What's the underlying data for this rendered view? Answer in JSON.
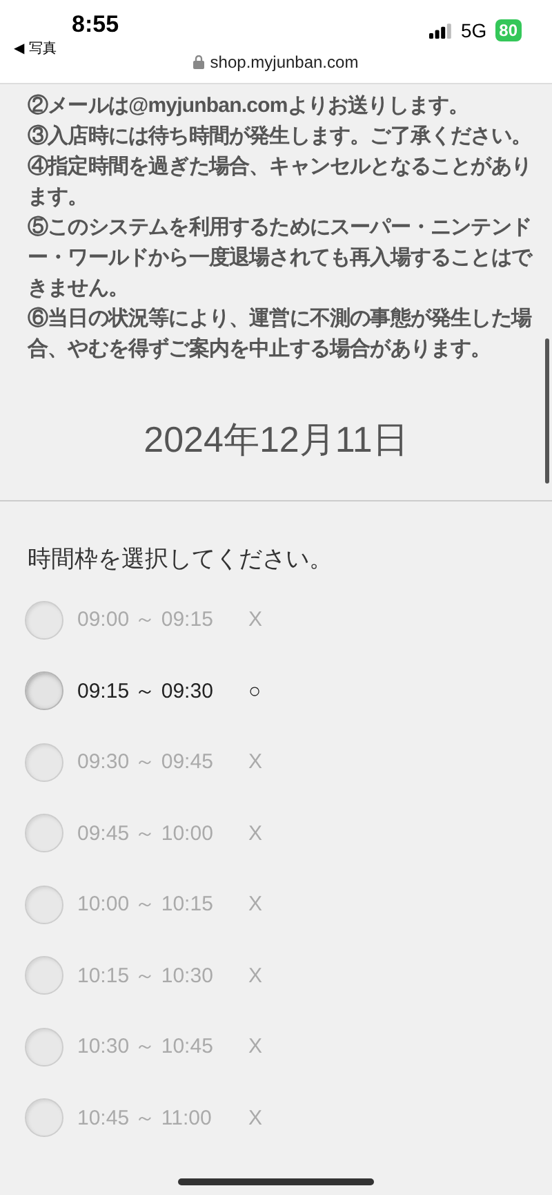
{
  "status_bar": {
    "time": "8:55",
    "back_arrow": "◀",
    "back_label": "写真",
    "network": "5G",
    "battery": "80"
  },
  "address_bar": {
    "url": "shop.myjunban.com"
  },
  "notes": [
    "②メールは@myjunban.comよりお送りします。",
    "③入店時には待ち時間が発生します。ご了承ください。",
    "④指定時間を過ぎた場合、キャンセルとなることがあります。",
    "⑤このシステムを利用するためにスーパー・ニンテンドー・ワールドから一度退場されても再入場することはできません。",
    "⑥当日の状況等により、運営に不測の事態が発生した場合、やむを得ずご案内を中止する場合があります。"
  ],
  "date": "2024年12月11日",
  "prompt": "時間枠を選択してください。",
  "slots": [
    {
      "time": "09:00 ～ 09:15",
      "mark": "X",
      "disabled": true
    },
    {
      "time": "09:15 ～ 09:30",
      "mark": "○",
      "disabled": false
    },
    {
      "time": "09:30 ～ 09:45",
      "mark": "X",
      "disabled": true
    },
    {
      "time": "09:45 ～ 10:00",
      "mark": "X",
      "disabled": true
    },
    {
      "time": "10:00 ～ 10:15",
      "mark": "X",
      "disabled": true
    },
    {
      "time": "10:15 ～ 10:30",
      "mark": "X",
      "disabled": true
    },
    {
      "time": "10:30 ～ 10:45",
      "mark": "X",
      "disabled": true
    },
    {
      "time": "10:45 ～ 11:00",
      "mark": "X",
      "disabled": true
    }
  ]
}
